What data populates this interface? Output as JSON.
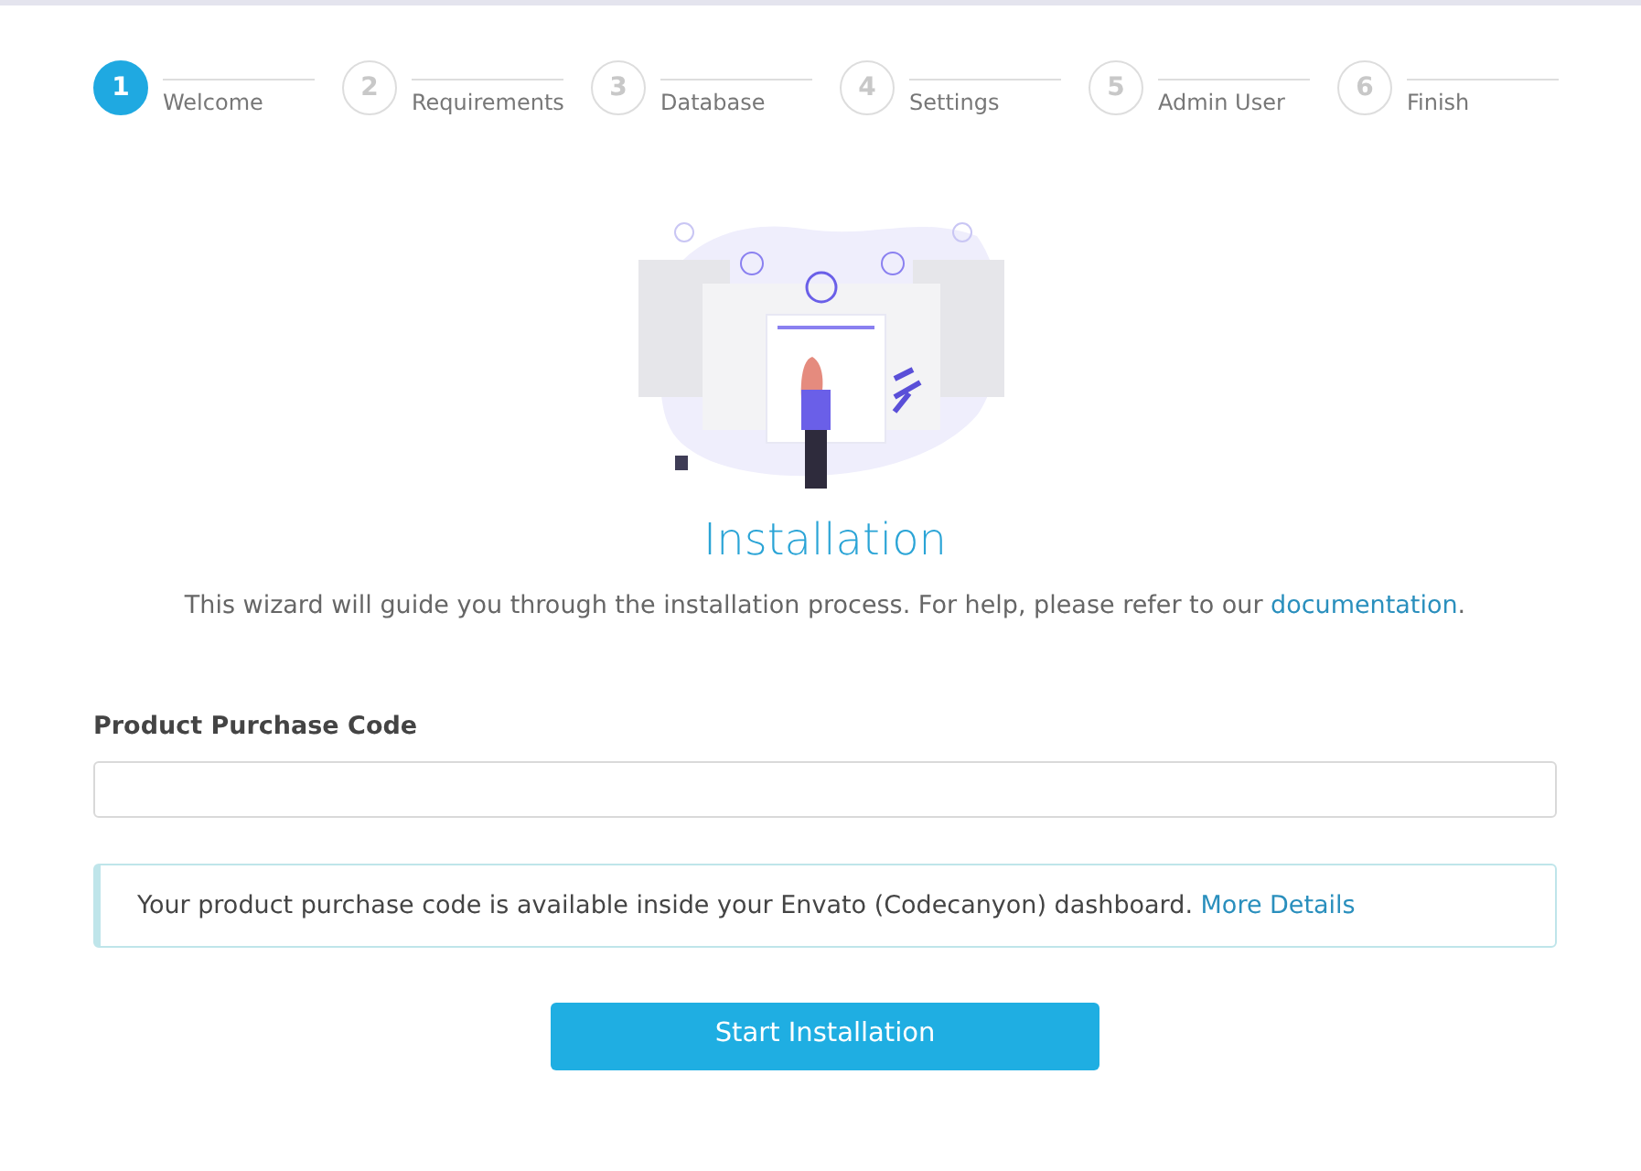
{
  "steps": [
    {
      "number": "1",
      "label": "Welcome",
      "selected": true
    },
    {
      "number": "2",
      "label": "Requirements",
      "selected": false
    },
    {
      "number": "3",
      "label": "Database",
      "selected": false
    },
    {
      "number": "4",
      "label": "Settings",
      "selected": false
    },
    {
      "number": "5",
      "label": "Admin User",
      "selected": false
    },
    {
      "number": "6",
      "label": "Finish",
      "selected": false
    }
  ],
  "title": "Installation",
  "intro": {
    "before": "This wizard will guide you through the installation process. For help, please refer to our ",
    "link": "documentation",
    "after": "."
  },
  "field": {
    "label": "Product Purchase Code"
  },
  "notice": {
    "text": "Your product purchase code is available inside your Envato (Codecanyon) dashboard. ",
    "link": "More Details"
  },
  "button": "Start Installation"
}
